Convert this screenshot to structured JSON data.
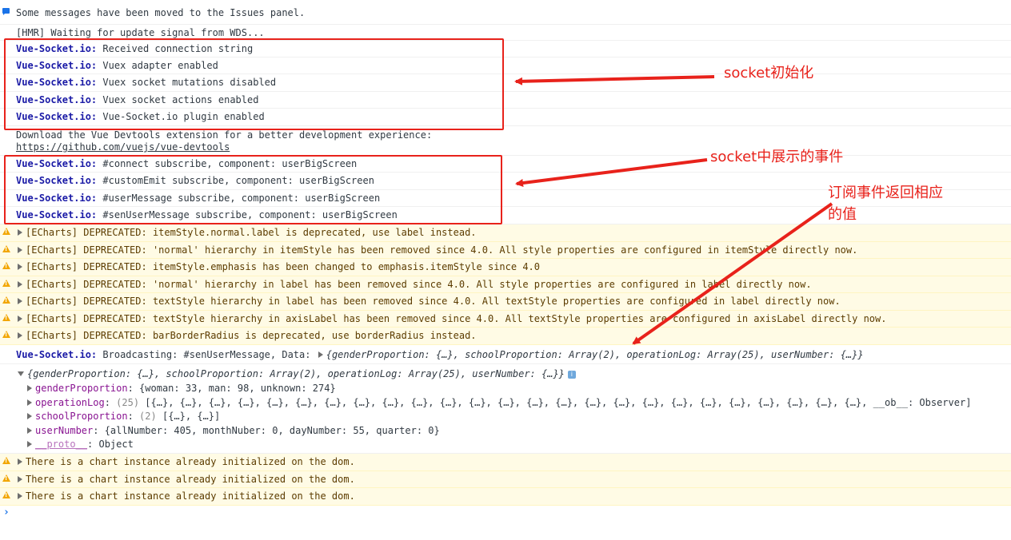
{
  "console": {
    "issues_msg": "Some messages have been moved to the Issues panel.",
    "hmr": "[HMR] Waiting for update signal from WDS...",
    "source": "Vue-Socket.io:",
    "init": [
      "Received connection string",
      "Vuex adapter enabled",
      "Vuex socket mutations disabled",
      "Vuex socket actions enabled",
      "Vue-Socket.io plugin enabled"
    ],
    "devtools_line1": "Download the Vue Devtools extension for a better development experience:",
    "devtools_link": "https://github.com/vuejs/vue-devtools",
    "events": [
      "#connect subscribe, component: userBigScreen",
      "#customEmit subscribe, component: userBigScreen",
      "#userMessage subscribe, component: userBigScreen",
      "#senUserMessage subscribe, component: userBigScreen"
    ],
    "warnings": [
      "[ECharts] DEPRECATED: itemStyle.normal.label is deprecated, use label instead.",
      "[ECharts] DEPRECATED: 'normal' hierarchy in itemStyle has been removed since 4.0. All style properties are configured in itemStyle directly now.",
      "[ECharts] DEPRECATED: itemStyle.emphasis has been changed to emphasis.itemStyle since 4.0",
      "[ECharts] DEPRECATED: 'normal' hierarchy in label has been removed since 4.0. All style properties are configured in label directly now.",
      "[ECharts] DEPRECATED: textStyle hierarchy in label has been removed since 4.0. All textStyle properties are configured in label directly now.",
      "[ECharts] DEPRECATED: textStyle hierarchy in axisLabel has been removed since 4.0. All textStyle properties are configured in axisLabel directly now.",
      "[ECharts] DEPRECATED: barBorderRadius is deprecated, use borderRadius instead."
    ],
    "broadcast_prefix": "Broadcasting: #senUserMessage, Data:",
    "broadcast_obj": "{genderProportion: {…}, schoolProportion: Array(2), operationLog: Array(25), userNumber: {…}}",
    "expanded_obj": "{genderProportion: {…}, schoolProportion: Array(2), operationLog: Array(25), userNumber: {…}}",
    "info_badge": "i",
    "props": {
      "gender_key": "genderProportion",
      "gender_val": "{woman: 33, man: 98, unknown: 274}",
      "oplog_key": "operationLog",
      "oplog_count": "(25)",
      "oplog_val": "[{…}, {…}, {…}, {…}, {…}, {…}, {…}, {…}, {…}, {…}, {…}, {…}, {…}, {…}, {…}, {…}, {…}, {…}, {…}, {…}, {…}, {…}, {…}, {…}, {…}, __ob__: Observer]",
      "school_key": "schoolProportion",
      "school_count": "(2)",
      "school_val": "[{…}, {…}]",
      "user_key": "userNumber",
      "user_val": "{allNumber: 405, monthNuber: 0, dayNumber: 55, quarter: 0}",
      "proto_key": "__proto__",
      "proto_val": "Object"
    },
    "chart_warnings": [
      "There is a chart instance already initialized on the dom.",
      "There is a chart instance already initialized on the dom.",
      "There is a chart instance already initialized on the dom."
    ],
    "prompt": "›"
  },
  "annotations": {
    "init_label": "socket初始化",
    "events_label": "socket中展示的事件",
    "subscribe_label_1": "订阅事件返回相应",
    "subscribe_label_2": "的值"
  },
  "colors": {
    "annotation": "#e8221b",
    "source": "#1a1aa6",
    "warning_bg": "#fffbe5"
  }
}
